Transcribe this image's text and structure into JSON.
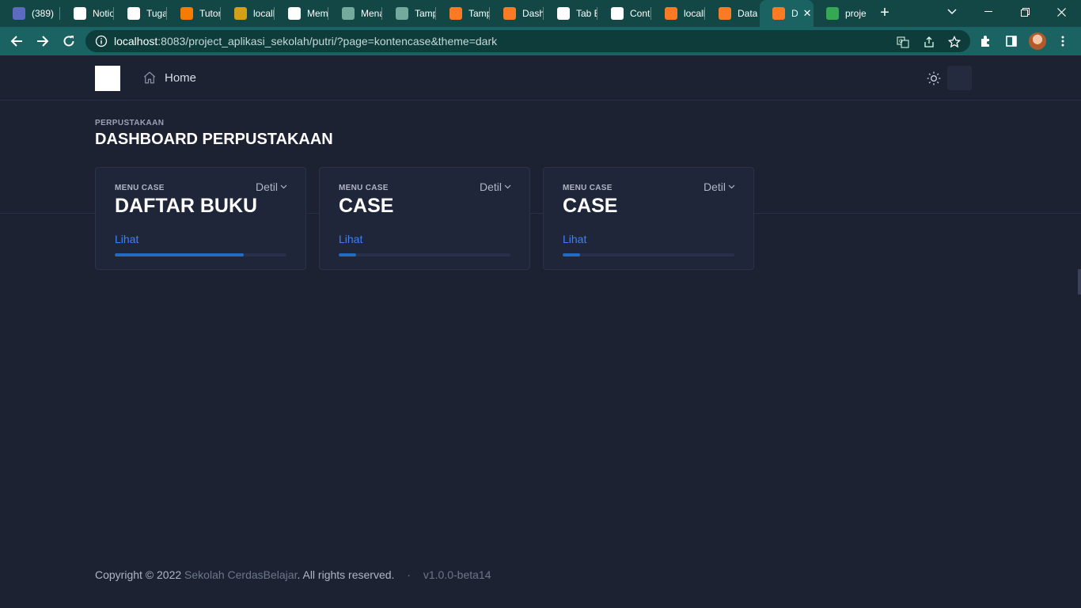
{
  "browser": {
    "tabs": [
      {
        "title": "(389)",
        "icon": "badge-389-icon",
        "color": "#5c6bc0",
        "active": false
      },
      {
        "title": "Notio",
        "icon": "notion-icon",
        "color": "#ffffff",
        "active": false
      },
      {
        "title": "Tugas",
        "icon": "notion-icon",
        "color": "#ffffff",
        "active": false
      },
      {
        "title": "Tutor",
        "icon": "blogger-icon",
        "color": "#f57c00",
        "active": false
      },
      {
        "title": "localh",
        "icon": "localhost-icon",
        "color": "#d4a017",
        "active": false
      },
      {
        "title": "Mem",
        "icon": "openai-icon",
        "color": "#ffffff",
        "active": false
      },
      {
        "title": "Mena",
        "icon": "chatgpt-icon",
        "color": "#74aa9c",
        "active": false
      },
      {
        "title": "Tamp",
        "icon": "chatgpt-icon",
        "color": "#74aa9c",
        "active": false
      },
      {
        "title": "Tamp",
        "icon": "xampp-icon",
        "color": "#fb7a24",
        "active": false
      },
      {
        "title": "Dash",
        "icon": "xampp-icon",
        "color": "#fb7a24",
        "active": false
      },
      {
        "title": "Tab B",
        "icon": "chrome-icon",
        "color": "#ffffff",
        "active": false
      },
      {
        "title": "Conto",
        "icon": "codepen-icon",
        "color": "#ffffff",
        "active": false
      },
      {
        "title": "localh",
        "icon": "xampp-icon",
        "color": "#fb7a24",
        "active": false
      },
      {
        "title": "Data",
        "icon": "xampp-icon",
        "color": "#fb7a24",
        "active": false
      },
      {
        "title": "D",
        "icon": "xampp-icon",
        "color": "#fb7a24",
        "active": true
      },
      {
        "title": "proje",
        "icon": "google-drive-icon",
        "color": "#34a853",
        "active": false
      }
    ],
    "url_host": "localhost",
    "url_rest": ":8083/project_aplikasi_sekolah/putri/?page=kontencase&theme=dark"
  },
  "nav": {
    "home_label": "Home"
  },
  "header": {
    "pretitle": "PERPUSTAKAAN",
    "title": "DASHBOARD PERPUSTAKAAN"
  },
  "cards": [
    {
      "subheader": "MENU CASE",
      "dropdown": "Detil",
      "value": "DAFTAR BUKU",
      "link": "Lihat",
      "progress": 0.75
    },
    {
      "subheader": "MENU CASE",
      "dropdown": "Detil",
      "value": "CASE",
      "link": "Lihat",
      "progress": 0.1
    },
    {
      "subheader": "MENU CASE",
      "dropdown": "Detil",
      "value": "CASE",
      "link": "Lihat",
      "progress": 0.1
    }
  ],
  "footer": {
    "copyright": "Copyright © 2022",
    "org": "Sekolah CerdasBelajar",
    "rights": ". All rights reserved.",
    "separator": "·",
    "version": "v1.0.0-beta14"
  },
  "colors": {
    "accent": "#206bc4",
    "link": "#3b82f6",
    "page_bg": "#1d2233",
    "card_bg": "#1f2639",
    "chrome": "#1a6362"
  }
}
